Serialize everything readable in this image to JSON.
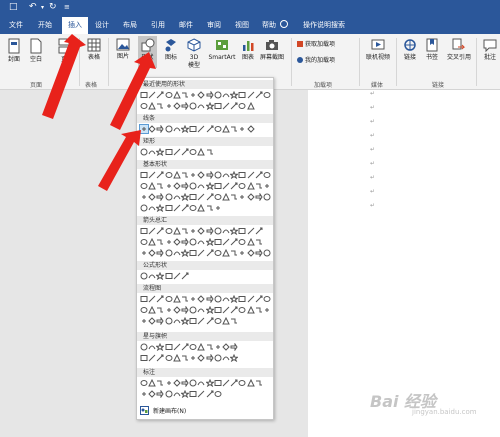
{
  "quick_access": {
    "icons": [
      "save-icon",
      "undo-icon",
      "redo-icon",
      "customize-icon"
    ]
  },
  "tabs": [
    {
      "label": "文件",
      "active": false
    },
    {
      "label": "开始",
      "active": false
    },
    {
      "label": "插入",
      "active": true
    },
    {
      "label": "设计",
      "active": false
    },
    {
      "label": "布局",
      "active": false
    },
    {
      "label": "引用",
      "active": false
    },
    {
      "label": "邮件",
      "active": false
    },
    {
      "label": "审阅",
      "active": false
    },
    {
      "label": "视图",
      "active": false
    },
    {
      "label": "帮助",
      "active": false
    }
  ],
  "tell_me": "操作说明搜索",
  "ribbon": {
    "cover": "封面",
    "blank": "空白",
    "page_break": "页",
    "table": "表格",
    "picture": "图片",
    "shapes": "形状",
    "icons_label": "图标",
    "model_3d": "3D 模型",
    "smartart": "SmartArt",
    "chart": "图表",
    "screenshot": "屏幕截图",
    "get_addins": "获取加载项",
    "my_addins": "我的加载项",
    "online_video": "联机视频",
    "link": "链接",
    "bookmark": "书签",
    "cross_ref": "交叉引用",
    "comment": "批注",
    "groups": {
      "pages": "页面",
      "tables": "表格",
      "addins": "加载项",
      "media": "媒体",
      "links": "链接"
    }
  },
  "shapes_menu": {
    "categories": [
      "最近使用的形状",
      "线条",
      "矩形",
      "基本形状",
      "箭头总汇",
      "公式形状",
      "流程图",
      "星与旗帜",
      "标注"
    ],
    "new_canvas": "新建画布(N)"
  },
  "document": {
    "paragraph_mark": "↵"
  },
  "watermark": {
    "main": "Bai  经验",
    "sub": "jingyan.baidu.com"
  },
  "colors": {
    "accent": "#2b579a",
    "arrow": "#e8221b"
  }
}
